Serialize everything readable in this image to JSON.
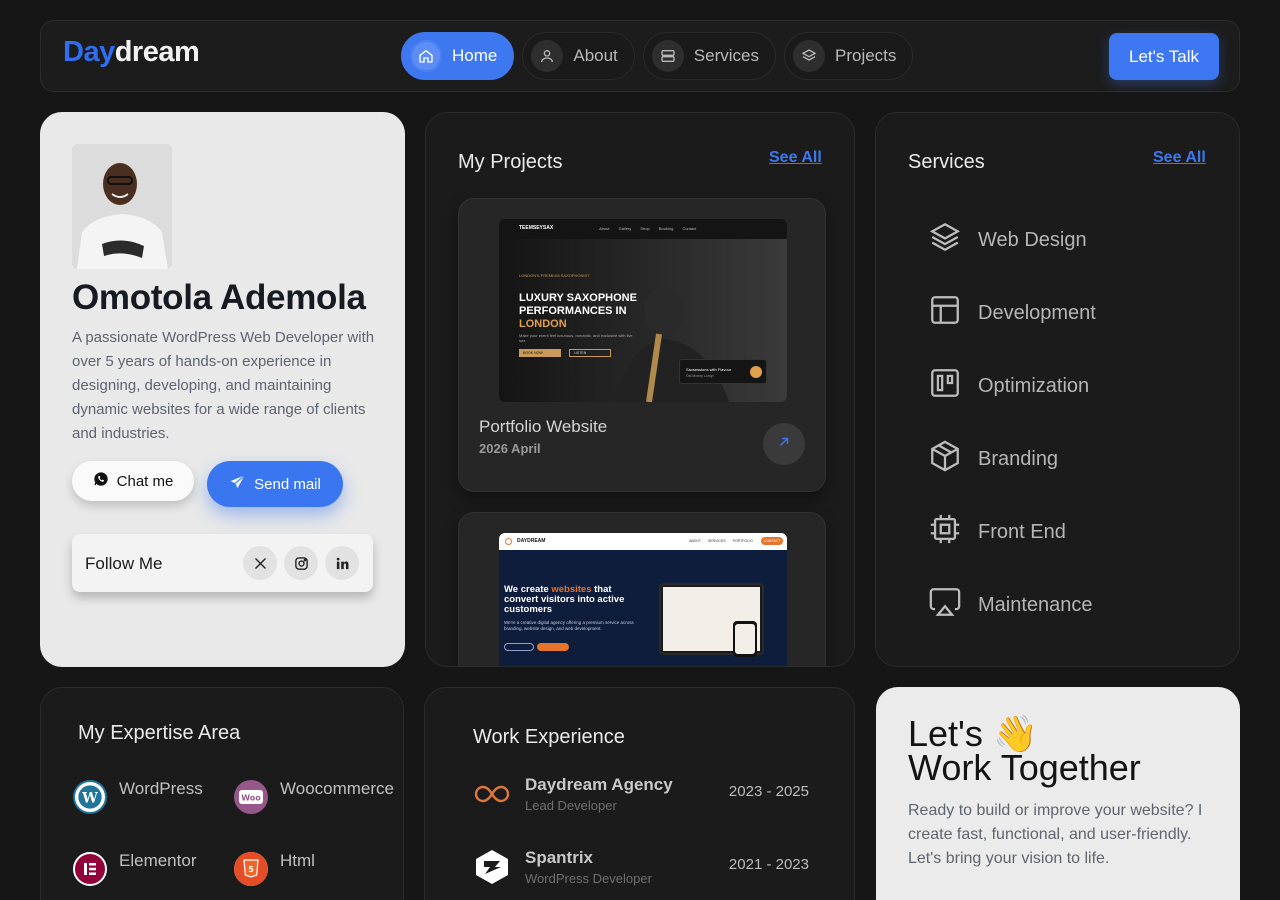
{
  "nav": {
    "logo_part1": "Day",
    "logo_part2": "dream",
    "links": [
      {
        "label": "Home",
        "icon": "home-icon",
        "active": true
      },
      {
        "label": "About",
        "icon": "user-icon",
        "active": false
      },
      {
        "label": "Services",
        "icon": "server-icon",
        "active": false
      },
      {
        "label": "Projects",
        "icon": "layers-icon",
        "active": false
      }
    ],
    "cta": "Let's Talk"
  },
  "profile": {
    "name": "Omotola Ademola",
    "bio": "A passionate WordPress Web Developer with over 5 years of hands-on experience in designing, developing, and maintaining dynamic websites for a wide range of clients and industries.",
    "chat_label": "Chat me",
    "mail_label": "Send mail",
    "follow_label": "Follow Me",
    "socials": [
      "x-icon",
      "instagram-icon",
      "linkedin-icon"
    ]
  },
  "projects": {
    "title": "My Projects",
    "see_all": "See All",
    "items": [
      {
        "name": "Portfolio Website",
        "date": "2026 April",
        "thumb": {
          "brand": "TEEMSEYSAX",
          "menu": [
            "About",
            "Gallery",
            "Shop",
            "Booking",
            "Contact"
          ],
          "kicker": "LONDON'S PREMIUM SAXOPHONIST",
          "headline_1": "LUXURY SAXOPHONE",
          "headline_2": "PERFORMANCES IN",
          "headline_3": "LONDON",
          "body": "Make your event feel luxurious, romantic, and exclusive with live sax.",
          "btn1": "BOOK NOW",
          "btn2": "LISTEN",
          "card_title": "Saxsessions with Flavour",
          "card_sub": "Old Money Lordy!"
        }
      },
      {
        "thumb": {
          "brand": "DAYDREAM",
          "menu": [
            "ABOUT",
            "SERVICES",
            "PORTFOLIO"
          ],
          "contact": "CONTACT",
          "h_1": "We create",
          "h_accent": "websites",
          "h_2": "that convert visitors into active customers",
          "body": "We're a creative digital agency offering a premium service across branding, website design, and web development."
        }
      }
    ]
  },
  "services": {
    "title": "Services",
    "see_all": "See All",
    "items": [
      {
        "label": "Web Design",
        "icon": "layers-icon"
      },
      {
        "label": "Development",
        "icon": "layout-icon"
      },
      {
        "label": "Optimization",
        "icon": "kanban-icon"
      },
      {
        "label": "Branding",
        "icon": "box-icon"
      },
      {
        "label": "Front End",
        "icon": "cpu-icon"
      },
      {
        "label": "Maintenance",
        "icon": "airplay-icon"
      }
    ]
  },
  "expertise": {
    "title": "My Expertise Area",
    "items": [
      {
        "label": "WordPress",
        "icon": "wordpress-icon",
        "color": "#21759b"
      },
      {
        "label": "Woocommerce",
        "icon": "woocommerce-icon",
        "color": "#96588a"
      },
      {
        "label": "Elementor",
        "icon": "elementor-icon",
        "color": "#92003b"
      },
      {
        "label": "Html",
        "icon": "html5-icon",
        "color": "#e44d26"
      }
    ]
  },
  "work": {
    "title": "Work Experience",
    "jobs": [
      {
        "company": "Daydream Agency",
        "role": "Lead Developer",
        "years": "2023 - 2025",
        "icon": "infinity-icon"
      },
      {
        "company": "Spantrix",
        "role": "WordPress Developer",
        "years": "2021 - 2023",
        "icon": "spantrix-icon"
      }
    ]
  },
  "together": {
    "line1": "Let's",
    "emoji": "👋",
    "line2": "Work Together",
    "body": "Ready to build or improve your website? I create fast, functional, and user-friendly. Let's bring your vision to life."
  },
  "colors": {
    "accent": "#3e78f0",
    "bg": "#161616",
    "card": "#1b1b1b",
    "light_card": "#e9e9e9"
  }
}
